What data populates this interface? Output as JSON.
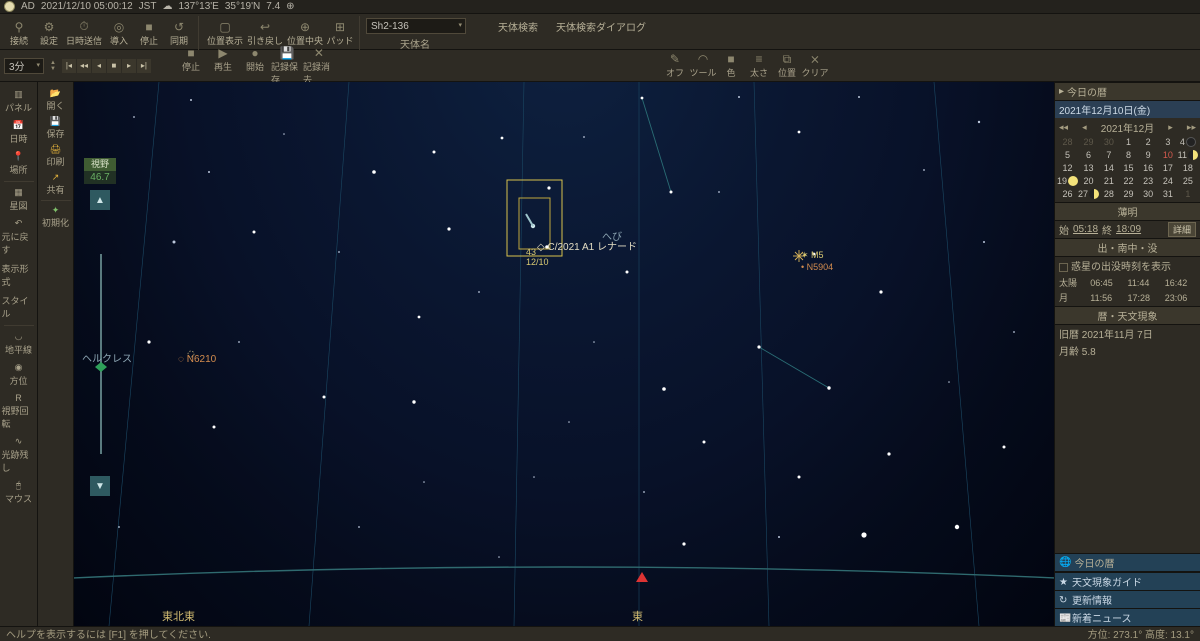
{
  "title": {
    "epoch": "AD",
    "datetime": "2021/12/10 05:00:12",
    "tz": "JST",
    "lon": "137°13'E",
    "lat": "35°19'N",
    "mag": "7.4"
  },
  "toolbar": {
    "g1": [
      "接続",
      "設定",
      "日時送信",
      "導入",
      "停止",
      "同期"
    ],
    "g2": [
      "位置表示",
      "引き戻し",
      "位置中央",
      "パッド"
    ],
    "search": {
      "value": "Sh2-136",
      "row_label": "天体名",
      "btn1": "天体検索",
      "btn2": "天体検索ダイアログ"
    }
  },
  "playback": {
    "step": "3分",
    "rec": [
      "停止",
      "再生",
      "開始",
      "記録保存",
      "記録消去"
    ]
  },
  "draw": [
    "オフ",
    "ツール",
    "色",
    "太さ",
    "位置",
    "クリア"
  ],
  "rail": [
    "パネル",
    "日時",
    "場所",
    "星図",
    "元に戻す",
    "表示形式",
    "スタイル",
    "地平線",
    "方位",
    "視野回転",
    "光跡残し",
    "マウス"
  ],
  "rail2": [
    "開く",
    "保存",
    "印刷",
    "共有",
    "初期化"
  ],
  "fov": {
    "label": "視野",
    "value": "46.7"
  },
  "sky": {
    "const_label": "ヘルクレス",
    "objects": {
      "n6210": "N6210",
      "comet": "C/2021 A1 レナード",
      "comet_date": "12/10",
      "comet_num": "43",
      "m5": "M5",
      "n5904": "N5904",
      "hebi": "へび"
    },
    "dir_ene": "東北東",
    "dir_e": "東"
  },
  "right": {
    "today_title": "今日の暦",
    "date_line": "2021年12月10日(金)",
    "cal_month": "2021年12月",
    "cal_days": [
      [
        {
          "t": "28",
          "mute": 1
        },
        {
          "t": "29",
          "mute": 1
        },
        {
          "t": "30",
          "mute": 1
        },
        {
          "t": "1"
        },
        {
          "t": "2"
        },
        {
          "t": "3"
        },
        {
          "t": "4",
          "moon": "new"
        }
      ],
      [
        {
          "t": "5"
        },
        {
          "t": "6"
        },
        {
          "t": "7"
        },
        {
          "t": "8"
        },
        {
          "t": "9"
        },
        {
          "t": "10",
          "red": 1
        },
        {
          "t": "11",
          "moon": "q"
        }
      ],
      [
        {
          "t": "12"
        },
        {
          "t": "13"
        },
        {
          "t": "14"
        },
        {
          "t": "15"
        },
        {
          "t": "16"
        },
        {
          "t": "17"
        },
        {
          "t": "18"
        }
      ],
      [
        {
          "t": "19",
          "moon": "full"
        },
        {
          "t": "20"
        },
        {
          "t": "21"
        },
        {
          "t": "22"
        },
        {
          "t": "23"
        },
        {
          "t": "24"
        },
        {
          "t": "25"
        }
      ],
      [
        {
          "t": "26"
        },
        {
          "t": "27",
          "moon": "q"
        },
        {
          "t": "28"
        },
        {
          "t": "29"
        },
        {
          "t": "30"
        },
        {
          "t": "31"
        },
        {
          "t": "1",
          "mute": 1
        }
      ]
    ],
    "twilight": {
      "title": "薄明",
      "start_l": "始",
      "start": "05:18",
      "end_l": "終",
      "end": "18:09",
      "detail": "詳細"
    },
    "rise": {
      "title": "出・南中・没",
      "chk_label": "惑星の出没時刻を表示",
      "rows": [
        {
          "name": "太陽",
          "a": "06:45",
          "b": "11:44",
          "c": "16:42"
        },
        {
          "name": "月",
          "a": "11:56",
          "b": "17:28",
          "c": "23:06"
        }
      ]
    },
    "phenom": {
      "title": "暦・天文現象",
      "l1": "旧暦 2021年11月 7日",
      "l2": "月齢 5.8"
    },
    "footer_title": "今日の暦",
    "links": [
      "天文現象ガイド",
      "更新情報",
      "新着ニュース"
    ]
  },
  "status": {
    "left": "ヘルプを表示するには [F1] を押してください.",
    "right": "方位: 273.1° 高度: 13.1°"
  }
}
